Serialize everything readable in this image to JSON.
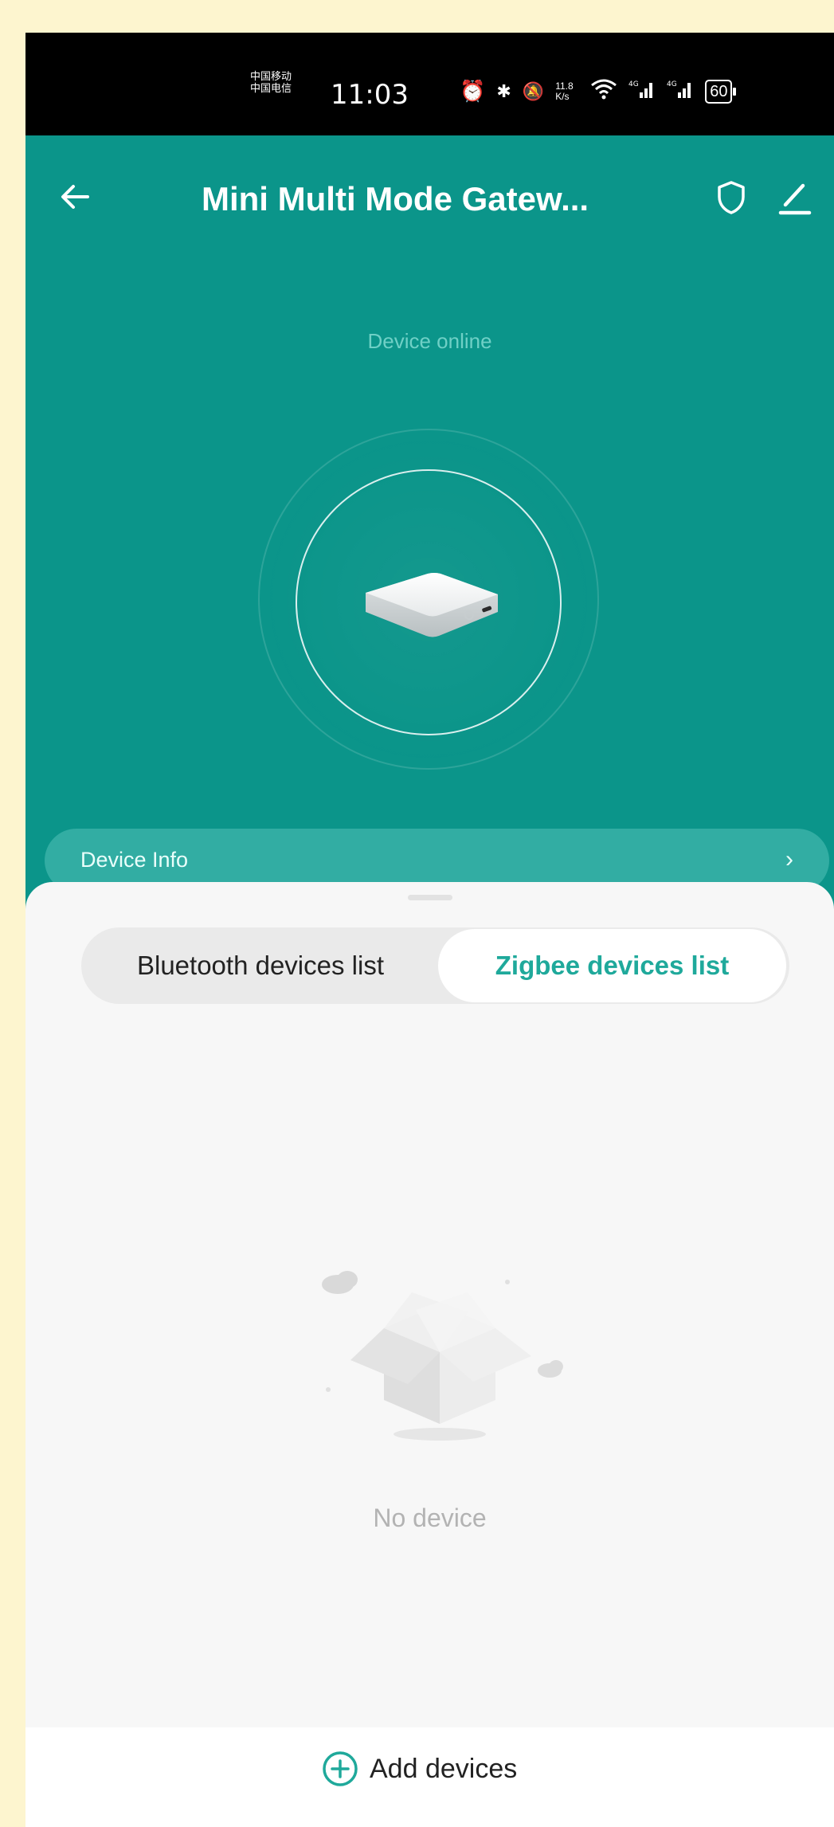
{
  "status_bar": {
    "carrier_1": "中国移动",
    "carrier_2": "中国电信",
    "time": "11:03",
    "net_speed": "11.8 K/s",
    "signal_1": "4G",
    "signal_2": "4G",
    "battery": "60",
    "icons": [
      "alarm-icon",
      "bluetooth-icon",
      "mute-icon",
      "wifi-icon",
      "signal-icon",
      "signal-icon",
      "battery-icon"
    ]
  },
  "header": {
    "title": "Mini Multi Mode Gatew...",
    "icons": [
      "back-arrow-icon",
      "shield-icon",
      "edit-icon"
    ]
  },
  "device": {
    "status": "Device online",
    "info_label": "Device Info",
    "info_arrow": "›"
  },
  "tabs": [
    {
      "label": "Bluetooth devices list",
      "selected": false
    },
    {
      "label": "Zigbee devices list",
      "selected": true
    }
  ],
  "empty_state": {
    "text": "No device"
  },
  "footer": {
    "add_label": "Add devices"
  },
  "colors": {
    "teal": "#0b958a",
    "accent": "#1fa99b",
    "info_bar": "#32ada3",
    "frame": "#fdf5cf"
  }
}
